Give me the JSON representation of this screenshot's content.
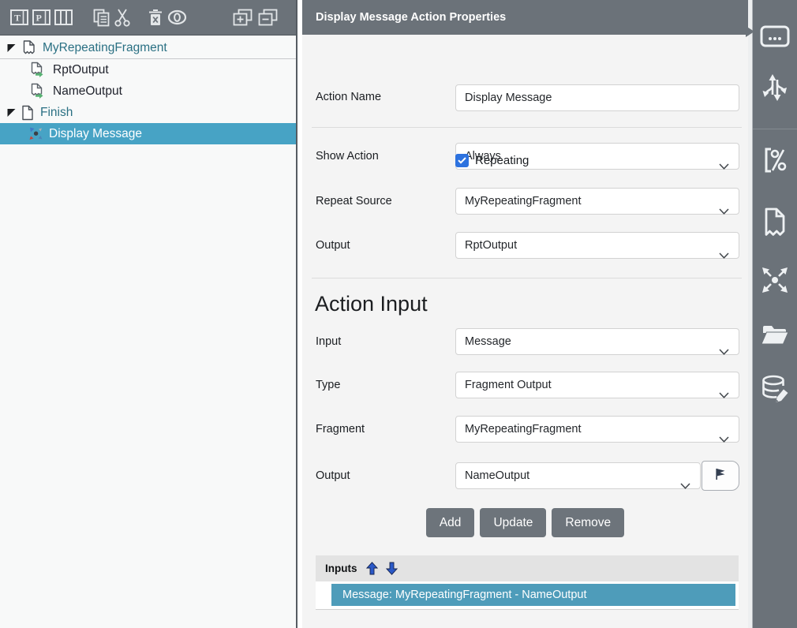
{
  "colors": {
    "chrome_gray": "#6b7279",
    "selected_teal_tree": "#47a3c5",
    "selected_teal_row": "#4e9cba",
    "checkbox_blue": "#2d72df",
    "tree_root_text": "#2a7083",
    "button_gray": "#6d747b",
    "panel_bg": "#f4f4f4"
  },
  "left_toolbar": {
    "icons": [
      "text-element",
      "paragraph-element",
      "columns-element",
      "copy",
      "cut",
      "delete",
      "visibility",
      "add-page",
      "remove-page"
    ]
  },
  "tree": {
    "items": [
      {
        "label": "MyRepeatingFragment",
        "level": 0,
        "icon": "fragment",
        "expanded": true,
        "selected": false,
        "separator": true,
        "labelColor": "teal"
      },
      {
        "label": "RptOutput",
        "level": 1,
        "icon": "output",
        "selected": false,
        "labelColor": "dark"
      },
      {
        "label": "NameOutput",
        "level": 1,
        "icon": "output",
        "selected": false,
        "labelColor": "dark"
      },
      {
        "label": "Finish",
        "level": 0,
        "icon": "page",
        "expanded": true,
        "selected": false,
        "labelColor": "teal"
      },
      {
        "label": "Display Message",
        "level": 1,
        "icon": "burst",
        "selected": true,
        "labelColor": "white"
      }
    ]
  },
  "properties": {
    "title": "Display Message Action Properties",
    "fields": {
      "action_name": {
        "label": "Action Name",
        "value": "Display Message"
      },
      "show_action": {
        "label": "Show Action",
        "value": "Always"
      },
      "repeating": {
        "label": "Repeating",
        "checked": true
      },
      "repeat_source": {
        "label": "Repeat Source",
        "value": "MyRepeatingFragment"
      },
      "output": {
        "label": "Output",
        "value": "RptOutput"
      }
    },
    "action_input": {
      "heading": "Action Input",
      "input": {
        "label": "Input",
        "value": "Message"
      },
      "type": {
        "label": "Type",
        "value": "Fragment Output"
      },
      "fragment": {
        "label": "Fragment",
        "value": "MyRepeatingFragment"
      },
      "output": {
        "label": "Output",
        "value": "NameOutput"
      }
    },
    "buttons": {
      "add": "Add",
      "update": "Update",
      "remove": "Remove"
    },
    "inputs_table": {
      "header": "Inputs",
      "rows": [
        {
          "text": "Message: MyRepeatingFragment - NameOutput",
          "selected": true
        }
      ]
    }
  },
  "right_sidebar": {
    "icons": [
      "ellipsis-box",
      "branch-arrows",
      "percent-bracket",
      "fragment",
      "scatter-arrows",
      "folder",
      "database-edit"
    ]
  }
}
